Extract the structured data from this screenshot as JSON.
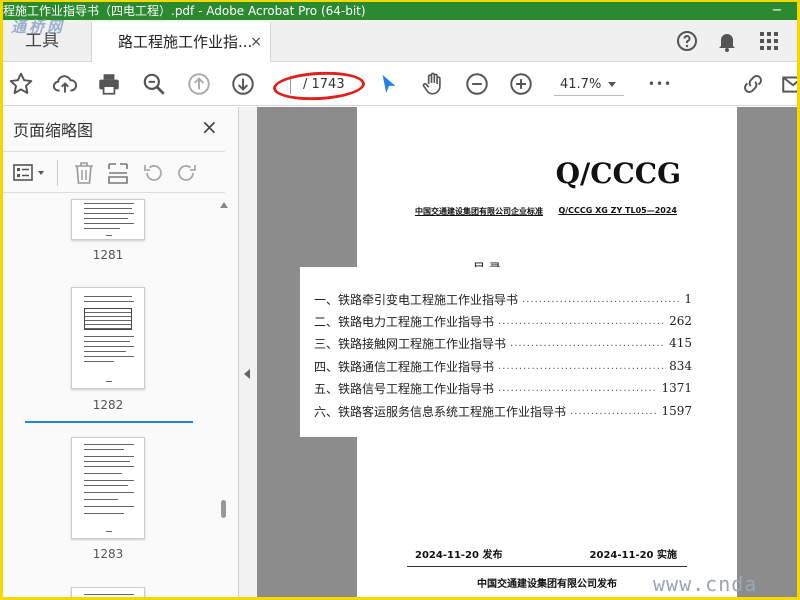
{
  "window": {
    "title": "程施工作业指导书（四电工程）.pdf - Adobe Acrobat Pro (64-bit)",
    "minimize": "−"
  },
  "tabs": {
    "tools_label": "工具",
    "document_label": "路工程施工作业指...",
    "close": "×"
  },
  "watermarks": {
    "top": "通桥网",
    "bottom": "www.cnda"
  },
  "toolbar": {
    "page_total": "/ 1743",
    "zoom_level": "41.7%",
    "more": "•••"
  },
  "sidebar": {
    "title": "页面缩略图",
    "close": "×",
    "thumbnails": [
      {
        "label": "1281"
      },
      {
        "label": "1282"
      },
      {
        "label": "1283"
      }
    ]
  },
  "document": {
    "standard_code": "Q/CCCG",
    "standard_org": "中国交通建设集团有限公司企业标准",
    "standard_number": "Q/CCCG XG ZY TL05—2024",
    "toc_heading_partial": "目 录",
    "toc": [
      {
        "title": "一、铁路牵引变电工程施工作业指导书",
        "page": "1"
      },
      {
        "title": "二、铁路电力工程施工作业指导书",
        "page": "262"
      },
      {
        "title": "三、铁路接触网工程施工作业指导书",
        "page": "415"
      },
      {
        "title": "四、铁路通信工程施工作业指导书",
        "page": "834"
      },
      {
        "title": "五、铁路信号工程施工作业指导书",
        "page": "1371"
      },
      {
        "title": "六、铁路客运服务信息系统工程施工作业指导书",
        "page": "1597"
      }
    ],
    "issue_date": "2024-11-20  发布",
    "effective_date": "2024-11-20  实施",
    "publisher": "中国交通建设集团有限公司发布"
  },
  "colors": {
    "title_bar": "#2b8a2f",
    "accent_blue": "#2680eb",
    "highlight_red": "#e0201c",
    "page_frame": "#f5d800"
  }
}
